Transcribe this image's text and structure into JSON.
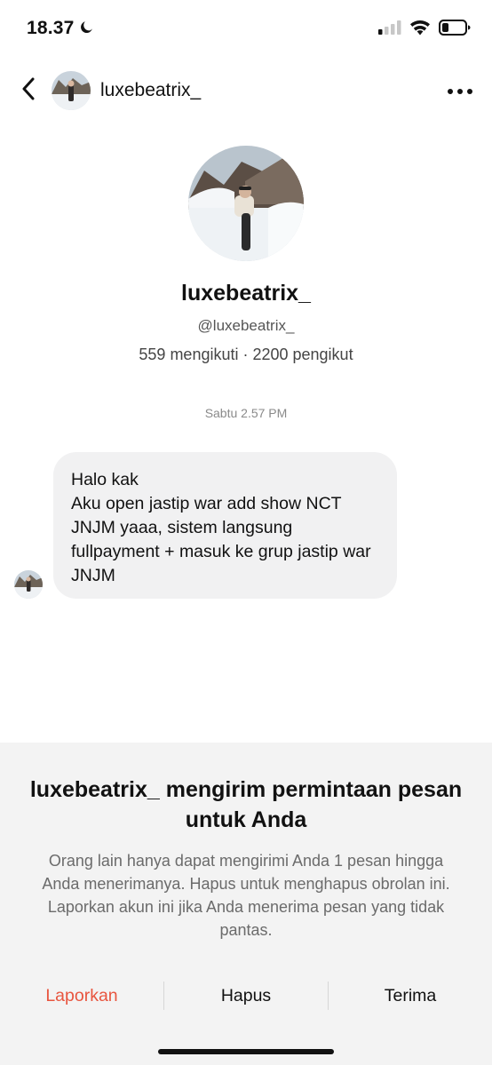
{
  "status_bar": {
    "time": "18.37",
    "icons": [
      "moon-icon",
      "signal-icon",
      "wifi-icon",
      "battery-icon"
    ]
  },
  "header": {
    "username": "luxebeatrix_",
    "icons": [
      "back-chevron-icon",
      "more-dots-icon"
    ]
  },
  "profile": {
    "display_name": "luxebeatrix_",
    "handle": "@luxebeatrix_",
    "stats": "559 mengikuti · 2200 pengikut"
  },
  "conversation": {
    "timestamp": "Sabtu 2.57 PM",
    "message": "Halo kak\nAku open jastip war add show NCT JNJM yaaa, sistem langsung fullpayment + masuk ke grup jastip war JNJM"
  },
  "request": {
    "title": "luxebeatrix_ mengirim permintaan pesan untuk Anda",
    "body": "Orang lain hanya dapat mengirimi Anda 1 pesan hingga Anda menerimanya. Hapus untuk menghapus obrolan ini. Laporkan akun ini jika Anda menerima pesan yang tidak pantas.",
    "actions": {
      "report": "Laporkan",
      "delete": "Hapus",
      "accept": "Terima"
    }
  },
  "colors": {
    "report_red": "#e8553f",
    "bubble_bg": "#f1f1f2",
    "panel_bg": "#f3f3f3"
  }
}
